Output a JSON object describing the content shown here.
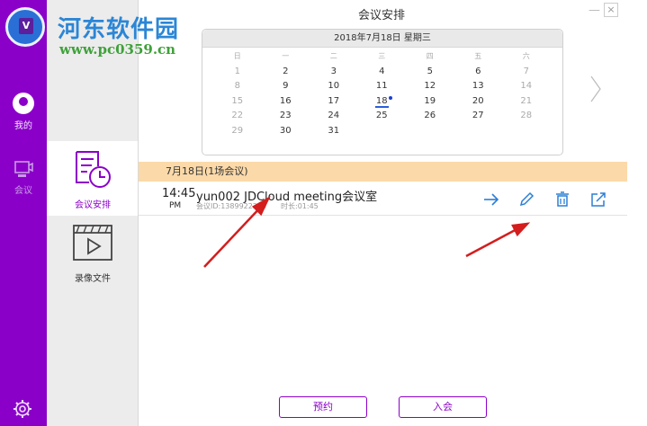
{
  "watermark": {
    "title": "河东软件园",
    "url": "www.pc0359.cn"
  },
  "rail": {
    "items": [
      {
        "label": "我的",
        "icon": "avatar-icon"
      },
      {
        "label": "会议",
        "icon": "meeting-icon"
      }
    ],
    "settings_icon": "gear-icon"
  },
  "nav": {
    "items": [
      {
        "label": "会议安排",
        "icon": "schedule-clock-icon",
        "active": true
      },
      {
        "label": "录像文件",
        "icon": "video-file-icon",
        "active": false
      }
    ]
  },
  "window": {
    "title": "会议安排",
    "minimize": "—",
    "close": "×"
  },
  "calendar": {
    "header": "2018年7月18日 星期三",
    "weekdays": [
      "日",
      "一",
      "二",
      "三",
      "四",
      "五",
      "六"
    ],
    "weeks": [
      [
        "1",
        "2",
        "3",
        "4",
        "5",
        "6",
        "7"
      ],
      [
        "8",
        "9",
        "10",
        "11",
        "12",
        "13",
        "14"
      ],
      [
        "15",
        "16",
        "17",
        "18",
        "19",
        "20",
        "21"
      ],
      [
        "22",
        "23",
        "24",
        "25",
        "26",
        "27",
        "28"
      ],
      [
        "29",
        "30",
        "31",
        "",
        "",
        "",
        ""
      ]
    ],
    "today": "18",
    "next_icon": "chevron-right-icon"
  },
  "day_bar": {
    "text": "7月18日(1场会议)"
  },
  "meeting": {
    "time": "14:45",
    "ampm": "PM",
    "name": "yun002 JDCloud meeting会议室",
    "id_text": "会议ID:1389922229",
    "duration_text": "时长:01:45",
    "actions": [
      "arrow-right-icon",
      "edit-pencil-icon",
      "delete-trash-icon",
      "share-export-icon"
    ]
  },
  "buttons": {
    "reserve": "预约",
    "join": "入会"
  },
  "colors": {
    "brand_purple": "#8b00c9",
    "day_bar": "#fbd9a9",
    "action_blue": "#2b7fd6",
    "annotation_red": "#d41d1d"
  }
}
